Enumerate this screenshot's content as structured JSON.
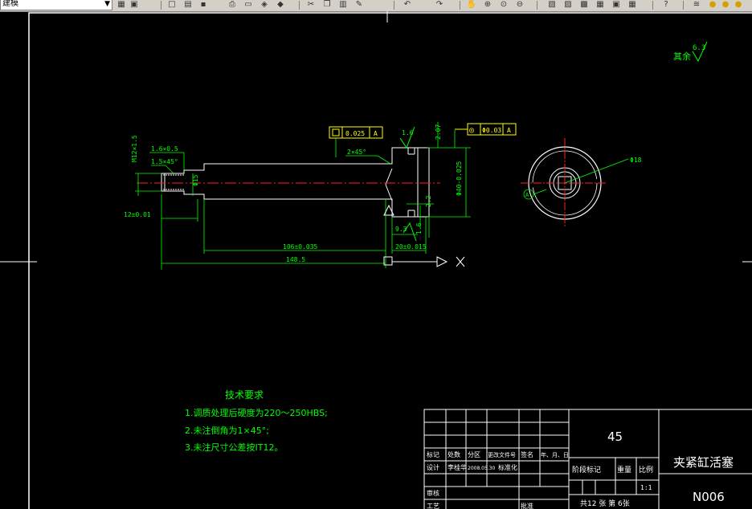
{
  "toolbar": {
    "workspace": "建模",
    "icons": [
      "layer-manager-icon",
      "layer-state-icon",
      "new-icon",
      "open-icon",
      "save-icon",
      "print-icon",
      "plot-preview-icon",
      "publish-icon",
      "3d-dwf-icon",
      "cut-icon",
      "copy-icon",
      "paste-icon",
      "match-properties-icon",
      "undo-icon",
      "redo-icon",
      "pan-icon",
      "zoom-realtime-icon",
      "zoom-window-icon",
      "zoom-previous-icon",
      "properties-icon",
      "design-center-icon",
      "tool-palettes-icon",
      "sheet-set-icon",
      "markup-icon",
      "quickcalc-icon",
      "help-icon",
      "layers-icon",
      "light-icon"
    ]
  },
  "drawing": {
    "colors": {
      "frame": "#ffffff",
      "dimension": "#00ff00",
      "centerline": "#ff2020",
      "callout": "#ffff00",
      "text": "#00ff00"
    },
    "surface_finish": {
      "label": "其余",
      "value": "6.3"
    },
    "gdt_left": {
      "tolerance": "0.025",
      "datum": "A"
    },
    "gdt_right": {
      "symbol": "◎",
      "tolerance": "Φ0.03",
      "datum": "A"
    },
    "roughness_top": "1.6",
    "roughness_bottom": "1.6",
    "dims": {
      "thread": "M12×1.5",
      "chamfer_a": "1.6×0.5",
      "chamfer_b": "1.5×45°",
      "dia_15": "Φ15",
      "chamfer_c": "2×45°",
      "dim_207": "2.07",
      "dia_40": "Φ40-0.025",
      "dim_93": "9.3",
      "dim_22": "2.2",
      "len_12": "12±0.01",
      "len_106": "106±0.035",
      "len_20": "20±0.015",
      "len_total": "148.5",
      "hole": "Φ18"
    },
    "datum_label": "A"
  },
  "tech_requirements": {
    "title": "技术要求",
    "items": [
      "1.调质处理后硬度为220～250HBS;",
      "2.未注倒角为1×45°;",
      "3.未注尺寸公差按IT12。"
    ]
  },
  "title_block": {
    "material": "45",
    "part_name": "夹紧缸活塞",
    "drawing_no": "N006",
    "scale": "1:1",
    "stage_row": [
      "阶段标记",
      "重量",
      "比例"
    ],
    "sheets": "共12 张 第 6张",
    "header_row": [
      "标记",
      "处数",
      "分区",
      "更改文件号",
      "签名",
      "年、月、日"
    ],
    "design_row": [
      "设计",
      "李桂华",
      "2008.05.30",
      "标准化"
    ],
    "review_label": "审核",
    "process_label": "工艺",
    "approve_label": "批准"
  }
}
